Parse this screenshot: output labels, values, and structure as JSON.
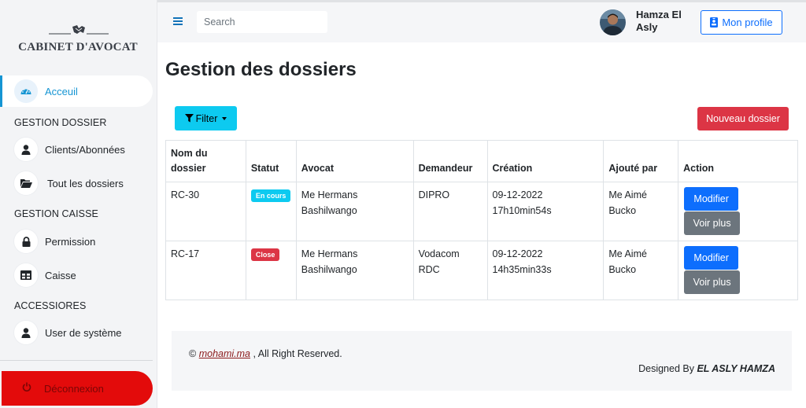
{
  "sidebar": {
    "logo_text": "CABINET D'AVOCAT",
    "items": [
      {
        "label": "Acceuil",
        "icon": "gauge-icon"
      },
      {
        "label": "Clients/Abonnées",
        "icon": "user-icon"
      },
      {
        "label": "Tout les dossiers",
        "icon": "folder-open-icon"
      },
      {
        "label": "Permission",
        "icon": "lock-icon"
      },
      {
        "label": "Caisse",
        "icon": "table-icon"
      },
      {
        "label": "User de système",
        "icon": "user-icon"
      }
    ],
    "headings": [
      "GESTION DOSSIER",
      "GESTION CAISSE",
      "ACCESSIORES"
    ],
    "logout_label": "Déconnexion",
    "accent": "#1595d3",
    "logout_color": "#e30b0b"
  },
  "topbar": {
    "search_placeholder": "Search",
    "user_name": "Hamza El Asly",
    "profile_label": "Mon profile"
  },
  "main": {
    "title": "Gestion des dossiers",
    "filter_label": "Filter",
    "new_label": "Nouveau dossier",
    "table": {
      "headers": [
        "Nom du dossier",
        "Statut",
        "Avocat",
        "Demandeur",
        "Création",
        "Ajouté par",
        "Action"
      ],
      "rows": [
        {
          "nom": "RC-30",
          "statut": "En cours",
          "avocat": "Me Hermans Bashilwango",
          "demandeur": "DIPRO",
          "creation": "09-12-2022 17h10min54s",
          "ajoute": "Me Aimé Bucko",
          "modifier": "Modifier",
          "voir": "Voir plus"
        },
        {
          "nom": "RC-17",
          "statut": "Close",
          "avocat": "Me Hermans Bashilwango",
          "demandeur": "Vodacom RDC",
          "creation": "09-12-2022 14h35min33s",
          "ajoute": "Me Aimé Bucko",
          "modifier": "Modifier",
          "voir": "Voir plus"
        }
      ]
    }
  },
  "footer": {
    "copyright_symbol": "©",
    "link_text": "mohami.ma",
    "rights_text": ", All Right Reserved.",
    "designed_prefix": "Designed By",
    "designer": "EL ASLY HAMZA"
  },
  "colors": {
    "primary": "#0d6efd",
    "info": "#0dcaf0",
    "danger": "#dc3545",
    "secondary": "#6c757d"
  }
}
